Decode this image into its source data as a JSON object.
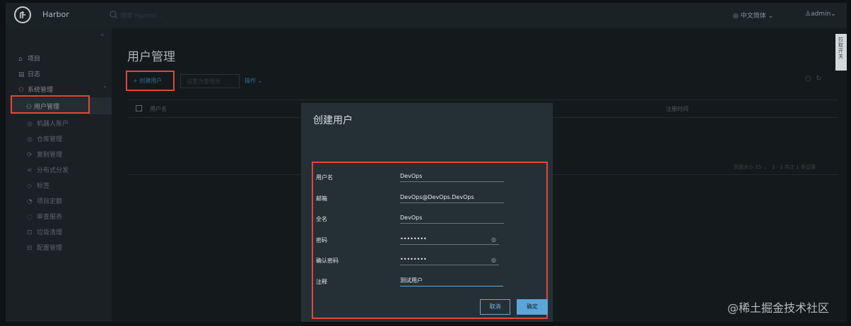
{
  "header": {
    "app_name": "Harbor",
    "search_placeholder": "搜索 Harbor...",
    "language": "中文简体",
    "user": "admin"
  },
  "sidebar": {
    "items": [
      {
        "icon": "project-icon",
        "label": "项目"
      },
      {
        "icon": "log-icon",
        "label": "日志"
      },
      {
        "icon": "admin-icon",
        "label": "系统管理"
      }
    ],
    "sub_items": [
      {
        "icon": "user-icon",
        "label": "用户管理",
        "active": true
      },
      {
        "icon": "robot-icon",
        "label": "机器人账户"
      },
      {
        "icon": "registry-icon",
        "label": "仓库管理"
      },
      {
        "icon": "replication-icon",
        "label": "复制管理"
      },
      {
        "icon": "distribution-icon",
        "label": "分布式分发"
      },
      {
        "icon": "label-icon",
        "label": "标签"
      },
      {
        "icon": "project-quota-icon",
        "label": "项目定额"
      },
      {
        "icon": "security-icon",
        "label": "审查服务"
      },
      {
        "icon": "gc-icon",
        "label": "垃圾清理"
      },
      {
        "icon": "config-icon",
        "label": "配置管理"
      }
    ]
  },
  "main": {
    "title": "用户管理",
    "toolbar": {
      "new_user": "+ 创建用户",
      "set_admin": "设置为管理员",
      "action": "操作"
    },
    "table": {
      "col_username": "用户名",
      "col_registered": "注册时间"
    },
    "pager": {
      "page_size_label": "页面大小",
      "page_size": "15",
      "range": "1 - 1 共计 1 条记录"
    },
    "side_tab": "拉取开关"
  },
  "modal": {
    "title": "创建用户",
    "fields": [
      {
        "label": "用户名",
        "value": "DevOps"
      },
      {
        "label": "邮箱",
        "value": "DevOps@DevOps.DevOps"
      },
      {
        "label": "全名",
        "value": "DevOps"
      },
      {
        "label": "密码",
        "value": "••••••••"
      },
      {
        "label": "确认密码",
        "value": "••••••••"
      },
      {
        "label": "注释",
        "value": "测试用户"
      }
    ],
    "cancel": "取消",
    "confirm": "确定"
  },
  "watermark": "@稀土掘金技术社区",
  "colors": {
    "accent": "#5aa6d9",
    "highlight_border": "#e2463d",
    "background": "#14191c",
    "modal": "#253036"
  }
}
